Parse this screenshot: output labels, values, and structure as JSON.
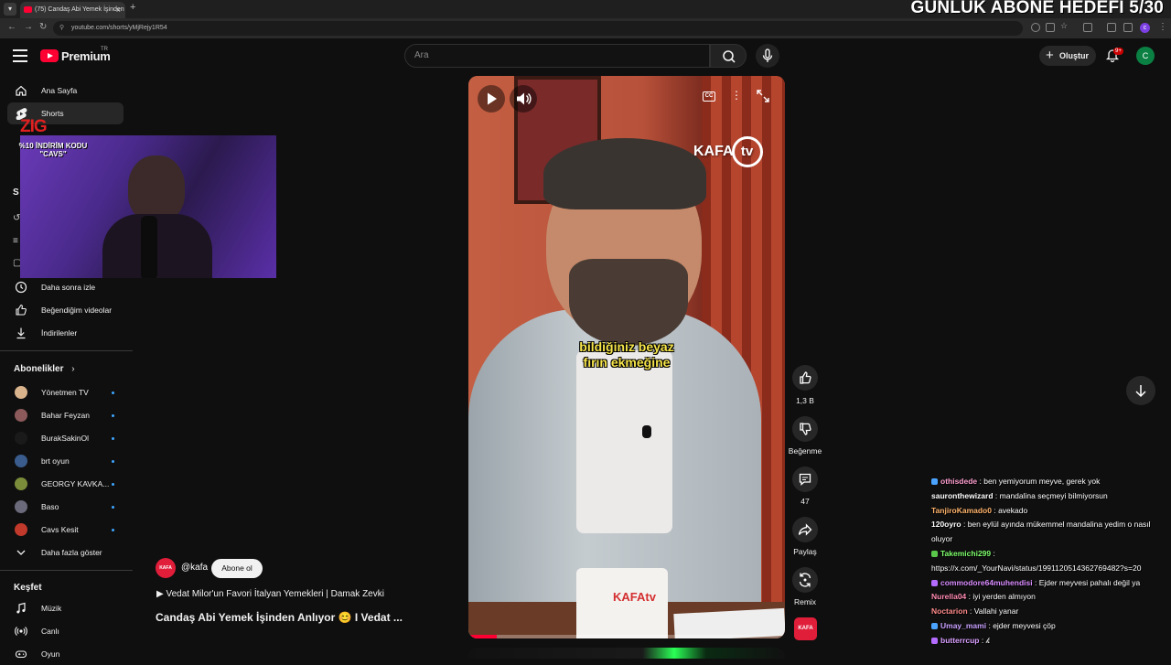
{
  "browser": {
    "tab_title": "(75) Candaş Abi Yemek İşinden",
    "url": "youtube.com/shorts/yMjRejy1R54",
    "new_tab": "+",
    "tab_close": "×",
    "profile_letter": "c"
  },
  "overlay": {
    "goal_text": "GÜNLÜK ABONE HEDEFİ 5/30",
    "promo_logo": "ZIG",
    "promo_text": "%10 İNDİRİM KODU \"CAVS\""
  },
  "header": {
    "logo_text": "Premium",
    "logo_region": "TR",
    "search_placeholder": "Ara",
    "create_label": "Oluştur",
    "notif_badge": "9+",
    "avatar_letter": "C"
  },
  "sidebar": {
    "items": [
      {
        "label": "Ana Sayfa",
        "icon": "home-icon"
      },
      {
        "label": "Shorts",
        "icon": "shorts-icon",
        "active": true
      },
      {
        "label": "Daha sonra izle",
        "icon": "clock-icon"
      },
      {
        "label": "Beğendiğim videolar",
        "icon": "thumbs-up-icon"
      },
      {
        "label": "İndirilenler",
        "icon": "download-icon"
      }
    ],
    "subscriptions_title": "Abonelikler",
    "subscriptions": [
      {
        "name": "Yönetmen TV",
        "color": "#d9b38c"
      },
      {
        "name": "Bahar Feyzan",
        "color": "#8c5a5a"
      },
      {
        "name": "BurakSakinOl",
        "color": "#1a1a1a"
      },
      {
        "name": "brt oyun",
        "color": "#3a5c8c"
      },
      {
        "name": "GEORGY KAVKA...",
        "color": "#7a8c3a"
      },
      {
        "name": "Baso",
        "color": "#6a6a7a"
      },
      {
        "name": "Cavs Kesit",
        "color": "#c0392b"
      }
    ],
    "show_more": "Daha fazla göster",
    "explore_title": "Keşfet",
    "explore": [
      {
        "label": "Müzik",
        "icon": "music-icon"
      },
      {
        "label": "Canlı",
        "icon": "live-icon"
      },
      {
        "label": "Oyun",
        "icon": "gaming-icon"
      }
    ]
  },
  "video": {
    "caption_line1": "bildiğiniz beyaz",
    "caption_line2": "fırın ekmeğine",
    "watermark": "KAFA",
    "watermark_tv": "tv",
    "mug_logo": "KAFAtv",
    "progress": 0.09
  },
  "actions": {
    "likes": "1,3 B",
    "dislike_label": "Beğenme",
    "comments": "47",
    "share_label": "Paylaş",
    "remix_label": "Remix",
    "channel_thumb_text": "KAFA"
  },
  "channel": {
    "avatar_text": "KAFA",
    "handle": "@kafa",
    "subscribe_label": "Abone ol",
    "playlist": "▶  Vedat Milor'un Favori İtalyan Yemekleri | Damak Zevki",
    "title": "Candaş Abi Yemek İşinden Anlıyor 😊 I Vedat ..."
  },
  "chat": [
    {
      "user": "othisdede",
      "color": "#ff9fd1",
      "badge": "#4aa3ff",
      "text": "ben yemiyorum meyve, gerek yok"
    },
    {
      "user": "sauronthewizard",
      "color": "#ffffff",
      "badge": "",
      "text": "mandalina seçmeyi bilmiyorsun"
    },
    {
      "user": "TanjiroKamado0",
      "color": "#ffb36b",
      "badge": "",
      "text": "avekado"
    },
    {
      "user": "120oyro",
      "color": "#ffffff",
      "badge": "",
      "text": "ben eylül ayında mükemmel mandalina yedim o nasıl"
    },
    {
      "user": "",
      "color": "#ffffff",
      "badge": "",
      "text": "oluyor"
    },
    {
      "user": "Takemichi299",
      "color": "#7dff6b",
      "badge": "#5ac84a",
      "text": ""
    },
    {
      "user": "",
      "color": "#ffffff",
      "badge": "",
      "text": "https://x.com/_YourNavi/status/1991120514362769482?s=20"
    },
    {
      "user": "commodore64muhendisi",
      "color": "#d98cff",
      "badge": "#b46bff",
      "text": "Ejder meyvesi pahalı değil ya"
    },
    {
      "user": "Nurella04",
      "color": "#ff8ab0",
      "badge": "",
      "text": "iyi yerden almıyon"
    },
    {
      "user": "Noctarion",
      "color": "#ff8a8a",
      "badge": "",
      "text": "Vallahi yanar"
    },
    {
      "user": "Umay_mami",
      "color": "#c9a0ff",
      "badge": "#4aa3ff",
      "text": "ejder meyvesi çöp"
    },
    {
      "user": "butterrcup",
      "color": "#d9a0ff",
      "badge": "#b46bff",
      "text": "𝓀"
    }
  ]
}
